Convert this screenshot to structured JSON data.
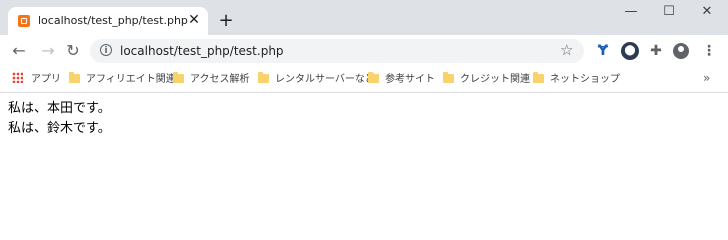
{
  "browser": {
    "tab": {
      "title": "localhost/test_php/test.php",
      "close_glyph": "✕",
      "favicon": "xampp-icon"
    },
    "new_tab_glyph": "+",
    "window_controls": {
      "minimize": "—",
      "maximize": "☐",
      "close": "✕"
    },
    "toolbar": {
      "back": "←",
      "forward": "→",
      "reload": "↻",
      "info": "i",
      "url": "localhost/test_php/test.php",
      "star": "☆",
      "extensions": [
        "vue-devtools-icon",
        "extension-badge-icon",
        "puzzle-icon",
        "profile-icon",
        "menu-icon"
      ],
      "extension_glyphs": [
        "Ɏ",
        "⬤",
        "✚",
        "",
        "⋮"
      ]
    },
    "bookmarks": {
      "apps_label": "アプリ",
      "items": [
        "アフィリエイト関連",
        "アクセス解析",
        "レンタルサーバーなど",
        "参考サイト",
        "クレジット関連",
        "ネットショップ"
      ],
      "more": "»"
    }
  },
  "page": {
    "lines": [
      "私は、本田です。",
      "私は、鈴木です。"
    ]
  },
  "colors": {
    "tabstrip": "#dee1e6",
    "omnibox": "#f1f3f4",
    "folder": "#f8d36b",
    "favicon": "#f5761a"
  }
}
